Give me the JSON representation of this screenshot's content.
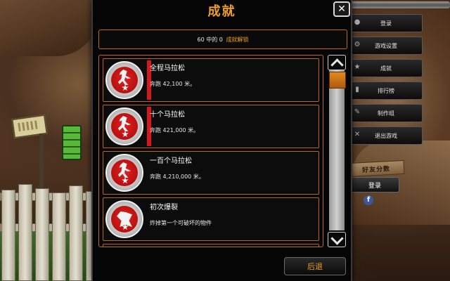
{
  "dialog": {
    "title": "成就",
    "close_label": "✕",
    "summary": {
      "prefix": "60 中的 0 ",
      "highlight": "成就解锁"
    },
    "back_label": "后退"
  },
  "achievements": [
    {
      "title": "全程马拉松",
      "desc": "奔跑 42,100 米。",
      "icon": "runner-icon",
      "progress": 1.0
    },
    {
      "title": "十个马拉松",
      "desc": "奔跑 421,000 米。",
      "icon": "runner-icon",
      "progress": 1.0
    },
    {
      "title": "一百个马拉松",
      "desc": "奔跑 4,210,000 米。",
      "icon": "runner-icon",
      "progress": 0.0
    },
    {
      "title": "初次爆裂",
      "desc": "炸掉第一个可破坏的物件",
      "icon": "fist-icon",
      "progress": 0.0
    }
  ],
  "side_menu": [
    {
      "label": "登录",
      "icon": "login-icon"
    },
    {
      "label": "游戏设置",
      "icon": "settings-icon"
    },
    {
      "label": "成就",
      "icon": "achievements-icon"
    },
    {
      "label": "排行榜",
      "icon": "leaderboard-icon"
    },
    {
      "label": "制作组",
      "icon": "credits-icon"
    },
    {
      "label": "退出游戏",
      "icon": "exit-icon"
    }
  ],
  "friends_panel": {
    "plank_label": "好友分数",
    "login_label": "登录",
    "facebook_icon": "f"
  },
  "colors": {
    "accent": "#f0a020",
    "frame": "#c06a18",
    "medal_red": "#d81818"
  }
}
